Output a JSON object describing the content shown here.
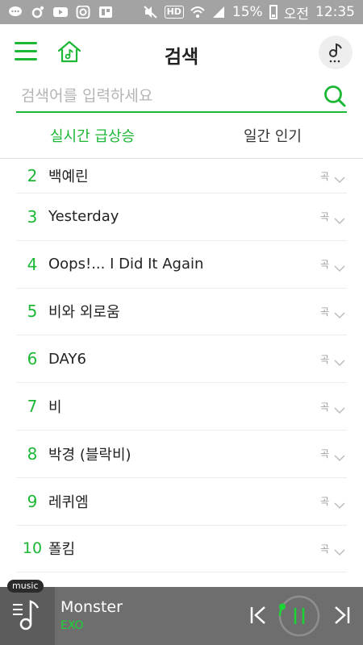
{
  "status_bar": {
    "battery_percent": "15%",
    "time_period": "오전",
    "time": "12:35",
    "hd_label": "HD",
    "icons": [
      "chat-icon",
      "link-icon",
      "youtube-icon",
      "instagram-icon",
      "gallery-icon",
      "mute-icon",
      "hd-voice-icon",
      "wifi-icon",
      "signal-icon",
      "battery-icon"
    ]
  },
  "header": {
    "title": "검색",
    "icons": [
      "menu-icon",
      "home-icon",
      "now-playing-icon"
    ]
  },
  "search": {
    "placeholder": "검색어를 입력하세요",
    "icon": "search-icon"
  },
  "tabs": [
    {
      "label": "실시간 급상승",
      "active": true
    },
    {
      "label": "일간 인기",
      "active": false
    }
  ],
  "rankings": [
    {
      "rank": "2",
      "title": "백예린",
      "type": "곡"
    },
    {
      "rank": "3",
      "title": "Yesterday",
      "type": "곡"
    },
    {
      "rank": "4",
      "title": "Oops!... I Did It Again",
      "type": "곡"
    },
    {
      "rank": "5",
      "title": "비와 외로움",
      "type": "곡"
    },
    {
      "rank": "6",
      "title": "DAY6",
      "type": "곡"
    },
    {
      "rank": "7",
      "title": "비",
      "type": "곡"
    },
    {
      "rank": "8",
      "title": "박경 (블락비)",
      "type": "곡"
    },
    {
      "rank": "9",
      "title": "레퀴엠",
      "type": "곡"
    },
    {
      "rank": "10",
      "title": "폴킴",
      "type": "곡"
    }
  ],
  "player": {
    "tag": "music",
    "song": "Monster",
    "artist": "EXO",
    "progress": 0.08,
    "icons": [
      "playlist-icon",
      "previous-icon",
      "pause-icon",
      "next-icon"
    ]
  },
  "colors": {
    "accent": "#1bb735",
    "status_bar": "#a3a3a3",
    "player_bg": "#6e6e6e"
  }
}
